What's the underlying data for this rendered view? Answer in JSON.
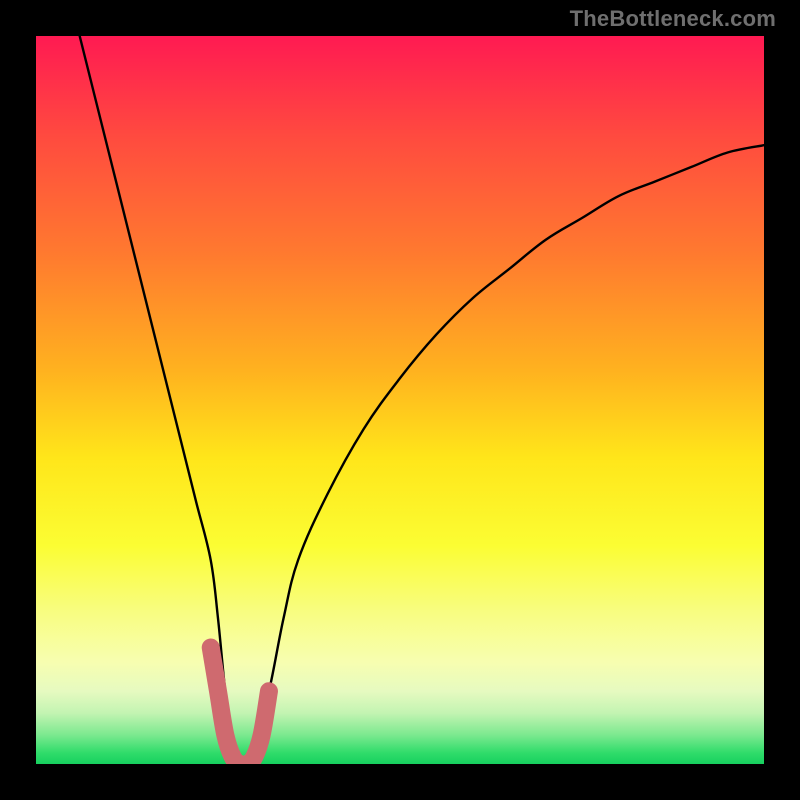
{
  "watermark": {
    "text": "TheBottleneck.com"
  },
  "chart_data": {
    "type": "line",
    "title": "",
    "xlabel": "",
    "ylabel": "",
    "xlim": [
      0,
      100
    ],
    "ylim": [
      0,
      100
    ],
    "grid": false,
    "legend": false,
    "series": [
      {
        "name": "bottleneck-curve",
        "color": "#000000",
        "x": [
          6,
          8,
          10,
          12,
          14,
          16,
          18,
          20,
          22,
          24,
          25,
          26,
          27,
          28,
          29,
          30,
          32,
          34,
          36,
          40,
          45,
          50,
          55,
          60,
          65,
          70,
          75,
          80,
          85,
          90,
          95,
          100
        ],
        "y": [
          100,
          92,
          84,
          76,
          68,
          60,
          52,
          44,
          36,
          28,
          20,
          10,
          3,
          0,
          0,
          3,
          10,
          20,
          28,
          37,
          46,
          53,
          59,
          64,
          68,
          72,
          75,
          78,
          80,
          82,
          84,
          85
        ]
      },
      {
        "name": "highlight-segment",
        "color": "#cf6a6f",
        "x": [
          24,
          25,
          26,
          27,
          28,
          29,
          30,
          31,
          32
        ],
        "y": [
          16,
          10,
          4,
          1,
          0,
          0,
          1,
          4,
          10
        ]
      }
    ],
    "background": {
      "type": "vertical-gradient",
      "stops": [
        {
          "offset": 0.0,
          "color": "#ff1a52"
        },
        {
          "offset": 0.14,
          "color": "#ff4b3f"
        },
        {
          "offset": 0.3,
          "color": "#ff7a2f"
        },
        {
          "offset": 0.46,
          "color": "#ffb21f"
        },
        {
          "offset": 0.58,
          "color": "#ffe61a"
        },
        {
          "offset": 0.7,
          "color": "#fbfd33"
        },
        {
          "offset": 0.79,
          "color": "#f8fd80"
        },
        {
          "offset": 0.86,
          "color": "#f7feb0"
        },
        {
          "offset": 0.9,
          "color": "#e6fac0"
        },
        {
          "offset": 0.93,
          "color": "#c3f4b2"
        },
        {
          "offset": 0.96,
          "color": "#7ce98f"
        },
        {
          "offset": 0.985,
          "color": "#2fdc6a"
        },
        {
          "offset": 1.0,
          "color": "#17d05f"
        }
      ]
    }
  }
}
